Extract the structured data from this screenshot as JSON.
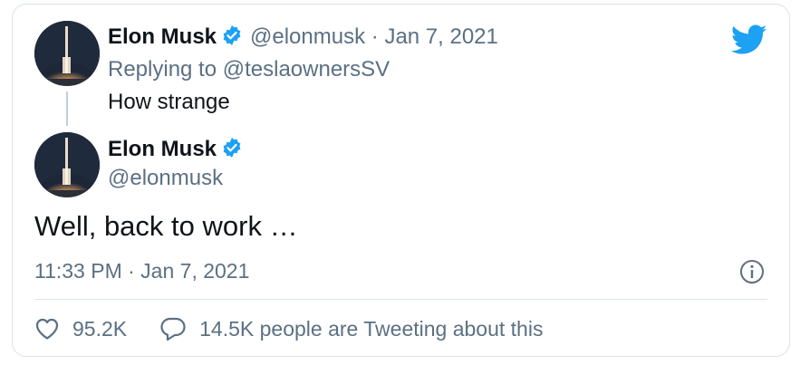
{
  "parent_tweet": {
    "author_name": "Elon Musk",
    "handle": "@elonmusk",
    "separator": "·",
    "date": "Jan 7, 2021",
    "replying_to_prefix": "Replying to",
    "replying_to_handle": "@teslaownersSV",
    "text": "How strange"
  },
  "main_tweet": {
    "author_name": "Elon Musk",
    "handle": "@elonmusk",
    "text": "Well, back to work …",
    "timestamp": "11:33 PM · Jan 7, 2021"
  },
  "actions": {
    "likes": "95.2K",
    "conversation": "14.5K people are Tweeting about this"
  },
  "icons": {
    "brand": "twitter-bird-icon",
    "verified": "verified-badge-icon",
    "info": "info-icon",
    "like": "heart-icon",
    "reply": "speech-bubble-icon"
  },
  "colors": {
    "brand_blue": "#1da1f2",
    "text_primary": "#0f1419",
    "text_secondary": "#5b7083",
    "border": "#dce3e8"
  }
}
